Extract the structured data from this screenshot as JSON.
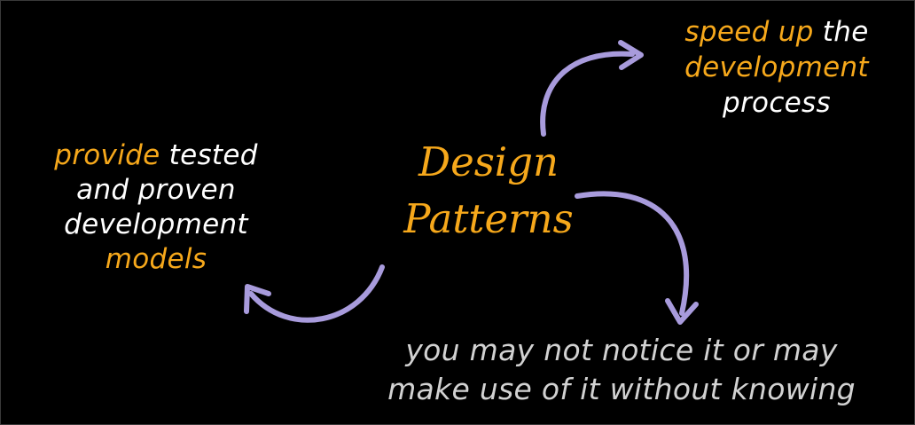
{
  "center": {
    "line1": "Design",
    "line2": "Patterns"
  },
  "left": {
    "line1_highlight": "provide",
    "line1_rest": " tested",
    "line2": "and proven",
    "line3": "development",
    "line4": "models"
  },
  "top_right": {
    "line1_highlight": "speed up",
    "line1_rest": " the",
    "line2": "development",
    "line3": "process"
  },
  "bottom": {
    "line1": "you may not notice it or may",
    "line2": "make use of it without knowing"
  },
  "colors": {
    "background": "#000000",
    "accent_yellow": "#f6a81b",
    "text_white": "#ffffff",
    "text_grey": "#d2d2d2",
    "arrow": "#a89bdc"
  }
}
